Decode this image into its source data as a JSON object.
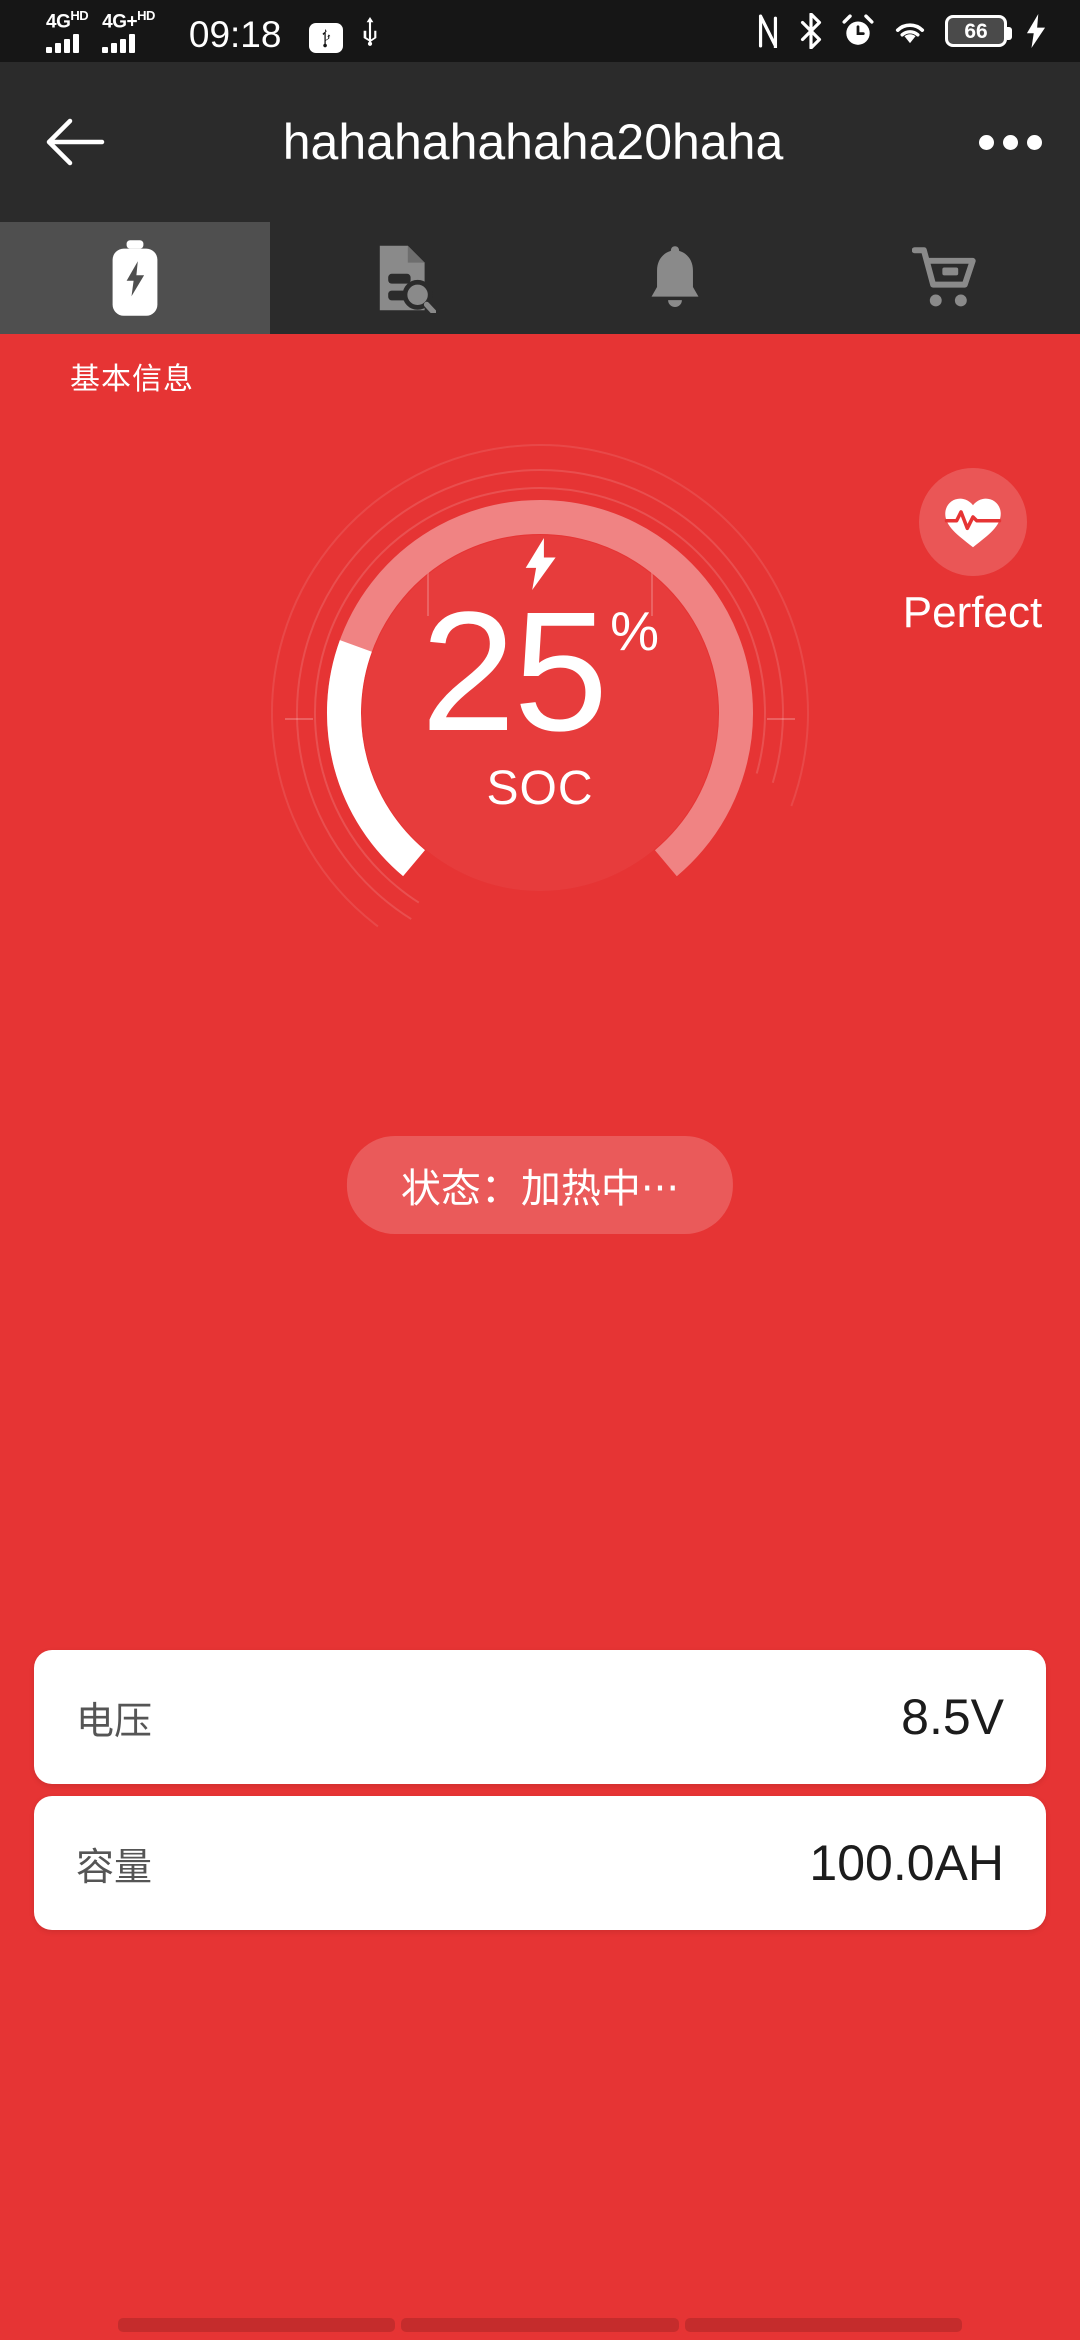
{
  "statusbar": {
    "network_1": "4G",
    "network_1_sup": "HD",
    "network_2": "4G+",
    "network_2_sup": "HD",
    "time": "09:18",
    "usb_debug_icon": "usb-debug-icon",
    "usb_icon": "usb-icon",
    "nfc_icon": "nfc-icon",
    "bluetooth_icon": "bluetooth-icon",
    "alarm_icon": "alarm-icon",
    "wifi_icon": "wifi-icon",
    "battery_percent": "66",
    "charging_icon": "charging-bolt-icon"
  },
  "header": {
    "back_icon": "back-arrow-icon",
    "title": "hahahahahaha20haha",
    "more_icon": "more-options-icon"
  },
  "tabs": [
    {
      "name": "tab-battery",
      "icon": "battery-charging-icon",
      "active": true
    },
    {
      "name": "tab-records",
      "icon": "document-search-icon",
      "active": false
    },
    {
      "name": "tab-alerts",
      "icon": "bell-icon",
      "active": false
    },
    {
      "name": "tab-shop",
      "icon": "shopping-cart-icon",
      "active": false
    }
  ],
  "main": {
    "section_label": "基本信息",
    "gauge": {
      "charging_icon": "lightning-bolt-icon",
      "value": "25",
      "percent_symbol": "%",
      "unit_label": "SOC"
    },
    "health": {
      "icon": "heart-pulse-icon",
      "label": "Perfect"
    },
    "status_pill": "状态：加热中···",
    "cards": [
      {
        "name": "voltage",
        "label": "电压",
        "value": "8.5V"
      },
      {
        "name": "capacity",
        "label": "容量",
        "value": "100.0AH"
      }
    ]
  },
  "chart_data": {
    "type": "gauge",
    "title": "SOC",
    "value": 25,
    "unit": "%",
    "range": [
      0,
      100
    ],
    "start_angle_deg": 130,
    "sweep_deg": 280,
    "track_color": "#F08383",
    "fill_color": "#FFFFFF",
    "background_color": "#E63434"
  },
  "colors": {
    "brand_red": "#E63434",
    "gauge_track": "#F08383",
    "gauge_fill": "#FFFFFF",
    "header_dark": "#2B2B2B",
    "tab_active": "#4F4F4F",
    "statusbar_dark": "#161616",
    "card_white": "#FFFFFF"
  },
  "navbar": {
    "gesture_bars": 3
  }
}
